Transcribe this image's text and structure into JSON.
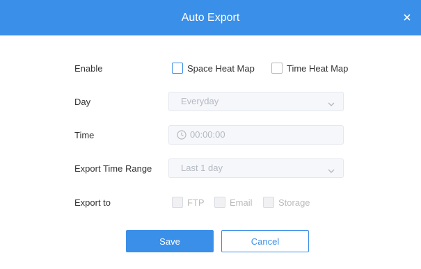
{
  "dialog": {
    "title": "Auto Export",
    "close_icon": "close-icon"
  },
  "form": {
    "enable": {
      "label": "Enable",
      "options": [
        {
          "label": "Space Heat Map",
          "checked": false,
          "state": "focused"
        },
        {
          "label": "Time Heat Map",
          "checked": false,
          "state": "normal"
        }
      ]
    },
    "day": {
      "label": "Day",
      "value": "Everyday",
      "disabled": true,
      "icon": "chevron-down-icon"
    },
    "time": {
      "label": "Time",
      "value": "00:00:00",
      "disabled": true,
      "icon": "clock-icon"
    },
    "export_time_range": {
      "label": "Export Time Range",
      "value": "Last 1 day",
      "disabled": true,
      "icon": "chevron-down-icon"
    },
    "export_to": {
      "label": "Export to",
      "options": [
        {
          "label": "FTP",
          "checked": false,
          "disabled": true
        },
        {
          "label": "Email",
          "checked": false,
          "disabled": true
        },
        {
          "label": "Storage",
          "checked": false,
          "disabled": true
        }
      ]
    }
  },
  "buttons": {
    "save": "Save",
    "cancel": "Cancel"
  },
  "colors": {
    "header": "#3a8fe8",
    "primary": "#3a8fe8",
    "disabled_bg": "#f5f7fa",
    "disabled_text": "#b5b9c2"
  }
}
